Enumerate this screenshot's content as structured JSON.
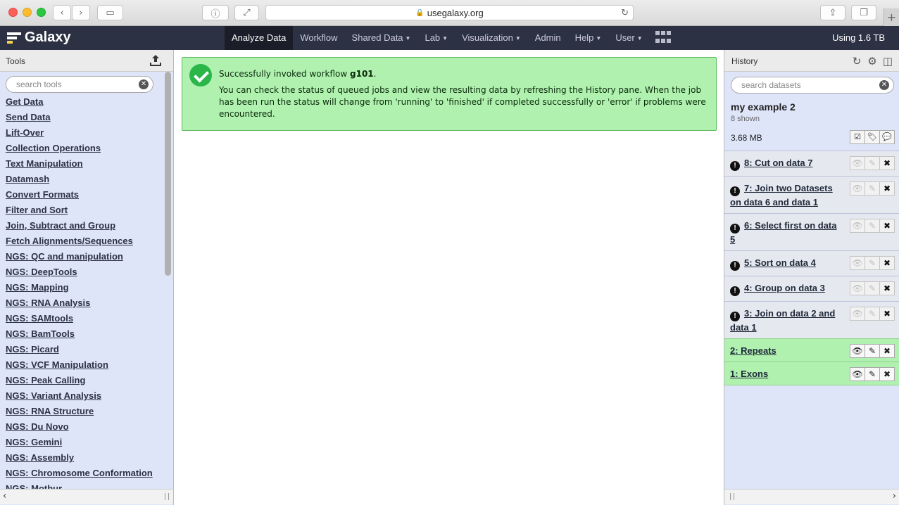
{
  "browser": {
    "url": "usegalaxy.org"
  },
  "masthead": {
    "brand": "Galaxy",
    "nav": [
      {
        "label": "Analyze Data",
        "dropdown": false,
        "active": true
      },
      {
        "label": "Workflow",
        "dropdown": false,
        "active": false
      },
      {
        "label": "Shared Data",
        "dropdown": true,
        "active": false
      },
      {
        "label": "Lab",
        "dropdown": true,
        "active": false
      },
      {
        "label": "Visualization",
        "dropdown": true,
        "active": false
      },
      {
        "label": "Admin",
        "dropdown": false,
        "active": false
      },
      {
        "label": "Help",
        "dropdown": true,
        "active": false
      },
      {
        "label": "User",
        "dropdown": true,
        "active": false
      }
    ],
    "quota": "Using 1.6 TB"
  },
  "tools": {
    "title": "Tools",
    "search_placeholder": "search tools",
    "items": [
      "Get Data",
      "Send Data",
      "Lift-Over",
      "Collection Operations",
      "Text Manipulation",
      "Datamash",
      "Convert Formats",
      "Filter and Sort",
      "Join, Subtract and Group",
      "Fetch Alignments/Sequences",
      "NGS: QC and manipulation",
      "NGS: DeepTools",
      "NGS: Mapping",
      "NGS: RNA Analysis",
      "NGS: SAMtools",
      "NGS: BamTools",
      "NGS: Picard",
      "NGS: VCF Manipulation",
      "NGS: Peak Calling",
      "NGS: Variant Analysis",
      "NGS: RNA Structure",
      "NGS: Du Novo",
      "NGS: Gemini",
      "NGS: Assembly",
      "NGS: Chromosome Conformation",
      "NGS: Mothur"
    ]
  },
  "message": {
    "prefix": "Successfully invoked workflow ",
    "workflow": "g101",
    "suffix": ".",
    "body": "You can check the status of queued jobs and view the resulting data by refreshing the History pane. When the job has been run the status will change from 'running' to 'finished' if completed successfully or 'error' if problems were encountered."
  },
  "history": {
    "title": "History",
    "search_placeholder": "search datasets",
    "name": "my example 2",
    "shown": "8 shown",
    "size": "3.68 MB",
    "datasets": [
      {
        "title": "8: Cut on data 7",
        "state": "error"
      },
      {
        "title": "7: Join two Datasets on data 6 and data 1",
        "state": "error"
      },
      {
        "title": "6: Select first on data 5",
        "state": "error"
      },
      {
        "title": "5: Sort on data 4",
        "state": "error"
      },
      {
        "title": "4: Group on data 3",
        "state": "error"
      },
      {
        "title": "3: Join on data 2 and data 1",
        "state": "error"
      },
      {
        "title": "2: Repeats",
        "state": "ok"
      },
      {
        "title": "1: Exons",
        "state": "ok"
      }
    ]
  },
  "colors": {
    "masthead": "#2c3143",
    "success_bg": "#b0f1b0",
    "panel_bg": "#dfe5f9"
  }
}
